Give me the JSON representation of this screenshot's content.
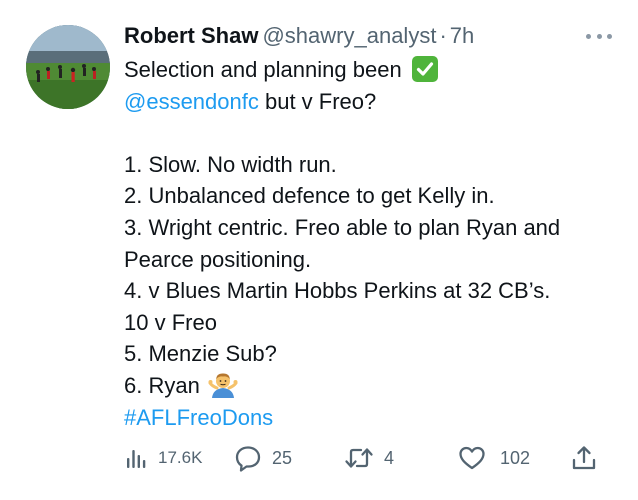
{
  "tweet": {
    "author_name": "Robert Shaw",
    "author_handle": "@shawry_analyst",
    "separator": "·",
    "time": "7h",
    "lines": {
      "l1": "Selection and planning been",
      "l2_link": "@essendonfc",
      "l2_rest": " but v Freo?",
      "l3": "1. Slow. No width run.",
      "l4": "2. Unbalanced defence to get  Kelly in.",
      "l5": "3. Wright centric. Freo able to plan Ryan and",
      "l6": "Pearce positioning.",
      "l7": "4. v Blues Martin Hobbs Perkins at 32 CB’s.",
      "l8": "10 v Freo",
      "l9": "5. Menzie Sub?",
      "l10": "6. Ryan",
      "hashtag": "#AFLFreoDons"
    },
    "emoji": {
      "check": "check-mark-button-emoji",
      "shrug": "man-shrugging-emoji"
    },
    "stats": {
      "views": "17.6K",
      "replies": "25",
      "retweets": "4",
      "likes": "102"
    },
    "colors": {
      "link": "#1d9bf0",
      "secondary": "#536471",
      "check_green": "#4fb43b"
    },
    "icons": {
      "views": "analytics-icon",
      "reply": "reply-icon",
      "retweet": "retweet-icon",
      "like": "heart-icon",
      "share": "share-icon",
      "more": "more-icon"
    }
  }
}
